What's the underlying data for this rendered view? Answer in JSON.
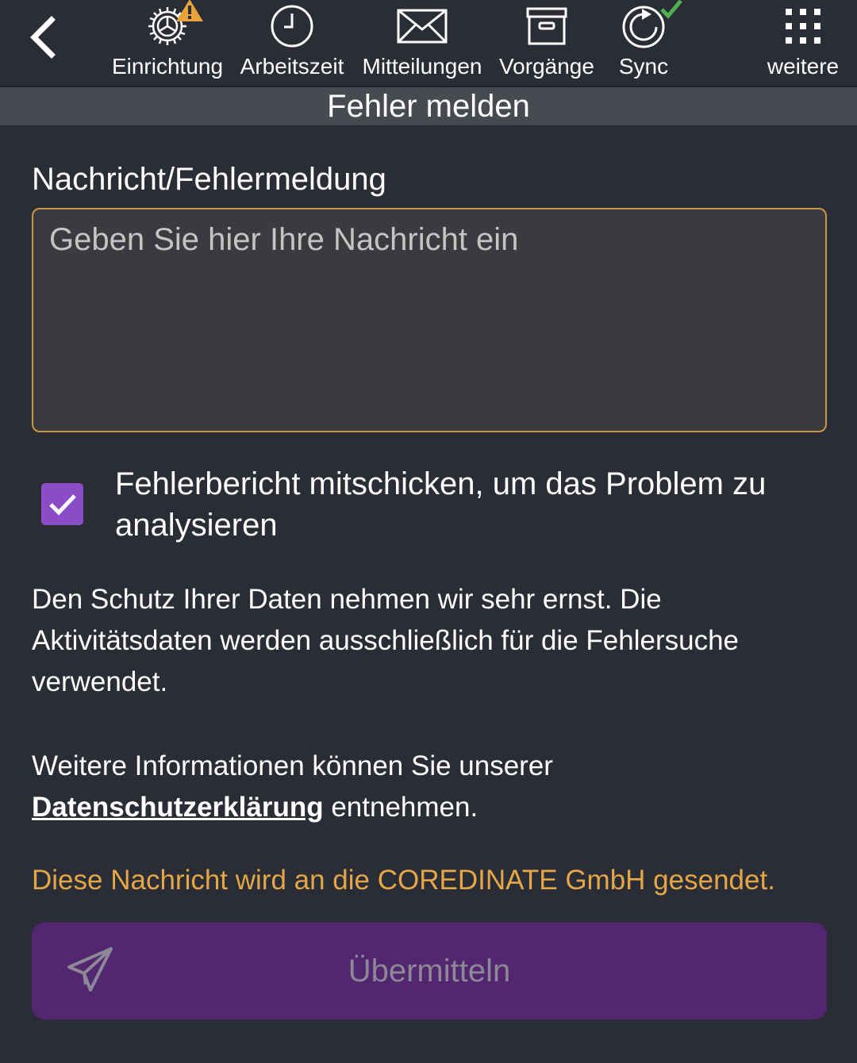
{
  "toolbar": {
    "back_icon": "chevron-left-icon",
    "items": [
      {
        "label": "Einrichtung",
        "icon": "gear-icon",
        "badge": "warning-icon"
      },
      {
        "label": "Arbeitszeit",
        "icon": "clock-icon"
      },
      {
        "label": "Mitteilungen",
        "icon": "envelope-icon"
      },
      {
        "label": "Vorgänge",
        "icon": "archive-box-icon"
      },
      {
        "label": "Sync",
        "icon": "sync-icon",
        "badge": "checkmark-icon"
      },
      {
        "label": "weitere",
        "icon": "grid-dots-icon"
      }
    ]
  },
  "page": {
    "title": "Fehler melden"
  },
  "form": {
    "message_label": "Nachricht/Fehlermeldung",
    "message_placeholder": "Geben Sie hier Ihre Nachricht ein",
    "message_value": "",
    "attach_report_label": "Fehlerbericht mitschicken, um das Problem zu analysieren",
    "attach_report_checked": true
  },
  "info": {
    "privacy_text": "Den Schutz Ihrer Daten nehmen wir sehr ernst. Die Aktivitätsdaten werden ausschließlich für die Fehlersuche verwendet.",
    "more_info_prefix": "Weitere Informationen können Sie unserer",
    "privacy_link": "Datenschutzerklärung",
    "more_info_suffix": " entnehmen.",
    "recipient_notice": "Diese Nachricht wird an die COREDINATE GmbH gesendet."
  },
  "actions": {
    "submit_label": "Übermitteln",
    "submit_icon": "paper-plane-icon"
  },
  "colors": {
    "background": "#2a2d35",
    "title_bar": "#474a50",
    "accent_orange": "#e4a646",
    "checkbox_purple": "#8b4cc7",
    "submit_purple": "#52276f",
    "warning_badge": "#e8a33a",
    "sync_ok": "#4caf50"
  }
}
